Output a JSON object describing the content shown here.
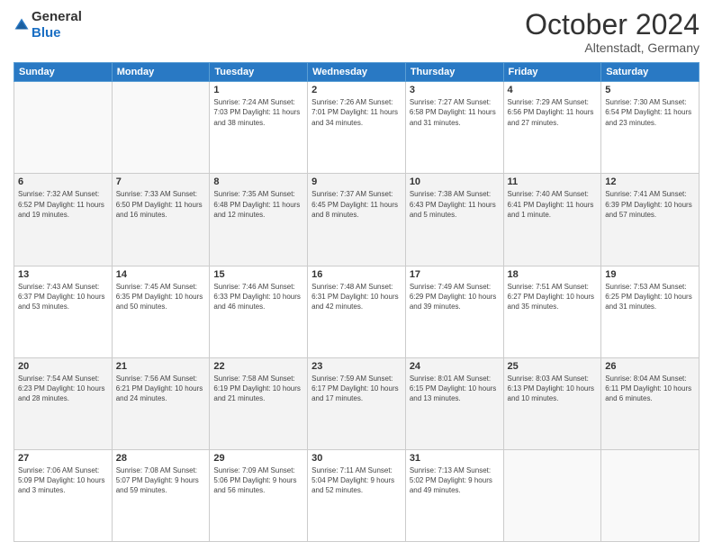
{
  "logo": {
    "general": "General",
    "blue": "Blue"
  },
  "header": {
    "month": "October 2024",
    "location": "Altenstadt, Germany"
  },
  "weekdays": [
    "Sunday",
    "Monday",
    "Tuesday",
    "Wednesday",
    "Thursday",
    "Friday",
    "Saturday"
  ],
  "weeks": [
    [
      {
        "day": "",
        "info": ""
      },
      {
        "day": "",
        "info": ""
      },
      {
        "day": "1",
        "info": "Sunrise: 7:24 AM\nSunset: 7:03 PM\nDaylight: 11 hours and 38 minutes."
      },
      {
        "day": "2",
        "info": "Sunrise: 7:26 AM\nSunset: 7:01 PM\nDaylight: 11 hours and 34 minutes."
      },
      {
        "day": "3",
        "info": "Sunrise: 7:27 AM\nSunset: 6:58 PM\nDaylight: 11 hours and 31 minutes."
      },
      {
        "day": "4",
        "info": "Sunrise: 7:29 AM\nSunset: 6:56 PM\nDaylight: 11 hours and 27 minutes."
      },
      {
        "day": "5",
        "info": "Sunrise: 7:30 AM\nSunset: 6:54 PM\nDaylight: 11 hours and 23 minutes."
      }
    ],
    [
      {
        "day": "6",
        "info": "Sunrise: 7:32 AM\nSunset: 6:52 PM\nDaylight: 11 hours and 19 minutes."
      },
      {
        "day": "7",
        "info": "Sunrise: 7:33 AM\nSunset: 6:50 PM\nDaylight: 11 hours and 16 minutes."
      },
      {
        "day": "8",
        "info": "Sunrise: 7:35 AM\nSunset: 6:48 PM\nDaylight: 11 hours and 12 minutes."
      },
      {
        "day": "9",
        "info": "Sunrise: 7:37 AM\nSunset: 6:45 PM\nDaylight: 11 hours and 8 minutes."
      },
      {
        "day": "10",
        "info": "Sunrise: 7:38 AM\nSunset: 6:43 PM\nDaylight: 11 hours and 5 minutes."
      },
      {
        "day": "11",
        "info": "Sunrise: 7:40 AM\nSunset: 6:41 PM\nDaylight: 11 hours and 1 minute."
      },
      {
        "day": "12",
        "info": "Sunrise: 7:41 AM\nSunset: 6:39 PM\nDaylight: 10 hours and 57 minutes."
      }
    ],
    [
      {
        "day": "13",
        "info": "Sunrise: 7:43 AM\nSunset: 6:37 PM\nDaylight: 10 hours and 53 minutes."
      },
      {
        "day": "14",
        "info": "Sunrise: 7:45 AM\nSunset: 6:35 PM\nDaylight: 10 hours and 50 minutes."
      },
      {
        "day": "15",
        "info": "Sunrise: 7:46 AM\nSunset: 6:33 PM\nDaylight: 10 hours and 46 minutes."
      },
      {
        "day": "16",
        "info": "Sunrise: 7:48 AM\nSunset: 6:31 PM\nDaylight: 10 hours and 42 minutes."
      },
      {
        "day": "17",
        "info": "Sunrise: 7:49 AM\nSunset: 6:29 PM\nDaylight: 10 hours and 39 minutes."
      },
      {
        "day": "18",
        "info": "Sunrise: 7:51 AM\nSunset: 6:27 PM\nDaylight: 10 hours and 35 minutes."
      },
      {
        "day": "19",
        "info": "Sunrise: 7:53 AM\nSunset: 6:25 PM\nDaylight: 10 hours and 31 minutes."
      }
    ],
    [
      {
        "day": "20",
        "info": "Sunrise: 7:54 AM\nSunset: 6:23 PM\nDaylight: 10 hours and 28 minutes."
      },
      {
        "day": "21",
        "info": "Sunrise: 7:56 AM\nSunset: 6:21 PM\nDaylight: 10 hours and 24 minutes."
      },
      {
        "day": "22",
        "info": "Sunrise: 7:58 AM\nSunset: 6:19 PM\nDaylight: 10 hours and 21 minutes."
      },
      {
        "day": "23",
        "info": "Sunrise: 7:59 AM\nSunset: 6:17 PM\nDaylight: 10 hours and 17 minutes."
      },
      {
        "day": "24",
        "info": "Sunrise: 8:01 AM\nSunset: 6:15 PM\nDaylight: 10 hours and 13 minutes."
      },
      {
        "day": "25",
        "info": "Sunrise: 8:03 AM\nSunset: 6:13 PM\nDaylight: 10 hours and 10 minutes."
      },
      {
        "day": "26",
        "info": "Sunrise: 8:04 AM\nSunset: 6:11 PM\nDaylight: 10 hours and 6 minutes."
      }
    ],
    [
      {
        "day": "27",
        "info": "Sunrise: 7:06 AM\nSunset: 5:09 PM\nDaylight: 10 hours and 3 minutes."
      },
      {
        "day": "28",
        "info": "Sunrise: 7:08 AM\nSunset: 5:07 PM\nDaylight: 9 hours and 59 minutes."
      },
      {
        "day": "29",
        "info": "Sunrise: 7:09 AM\nSunset: 5:06 PM\nDaylight: 9 hours and 56 minutes."
      },
      {
        "day": "30",
        "info": "Sunrise: 7:11 AM\nSunset: 5:04 PM\nDaylight: 9 hours and 52 minutes."
      },
      {
        "day": "31",
        "info": "Sunrise: 7:13 AM\nSunset: 5:02 PM\nDaylight: 9 hours and 49 minutes."
      },
      {
        "day": "",
        "info": ""
      },
      {
        "day": "",
        "info": ""
      }
    ]
  ]
}
